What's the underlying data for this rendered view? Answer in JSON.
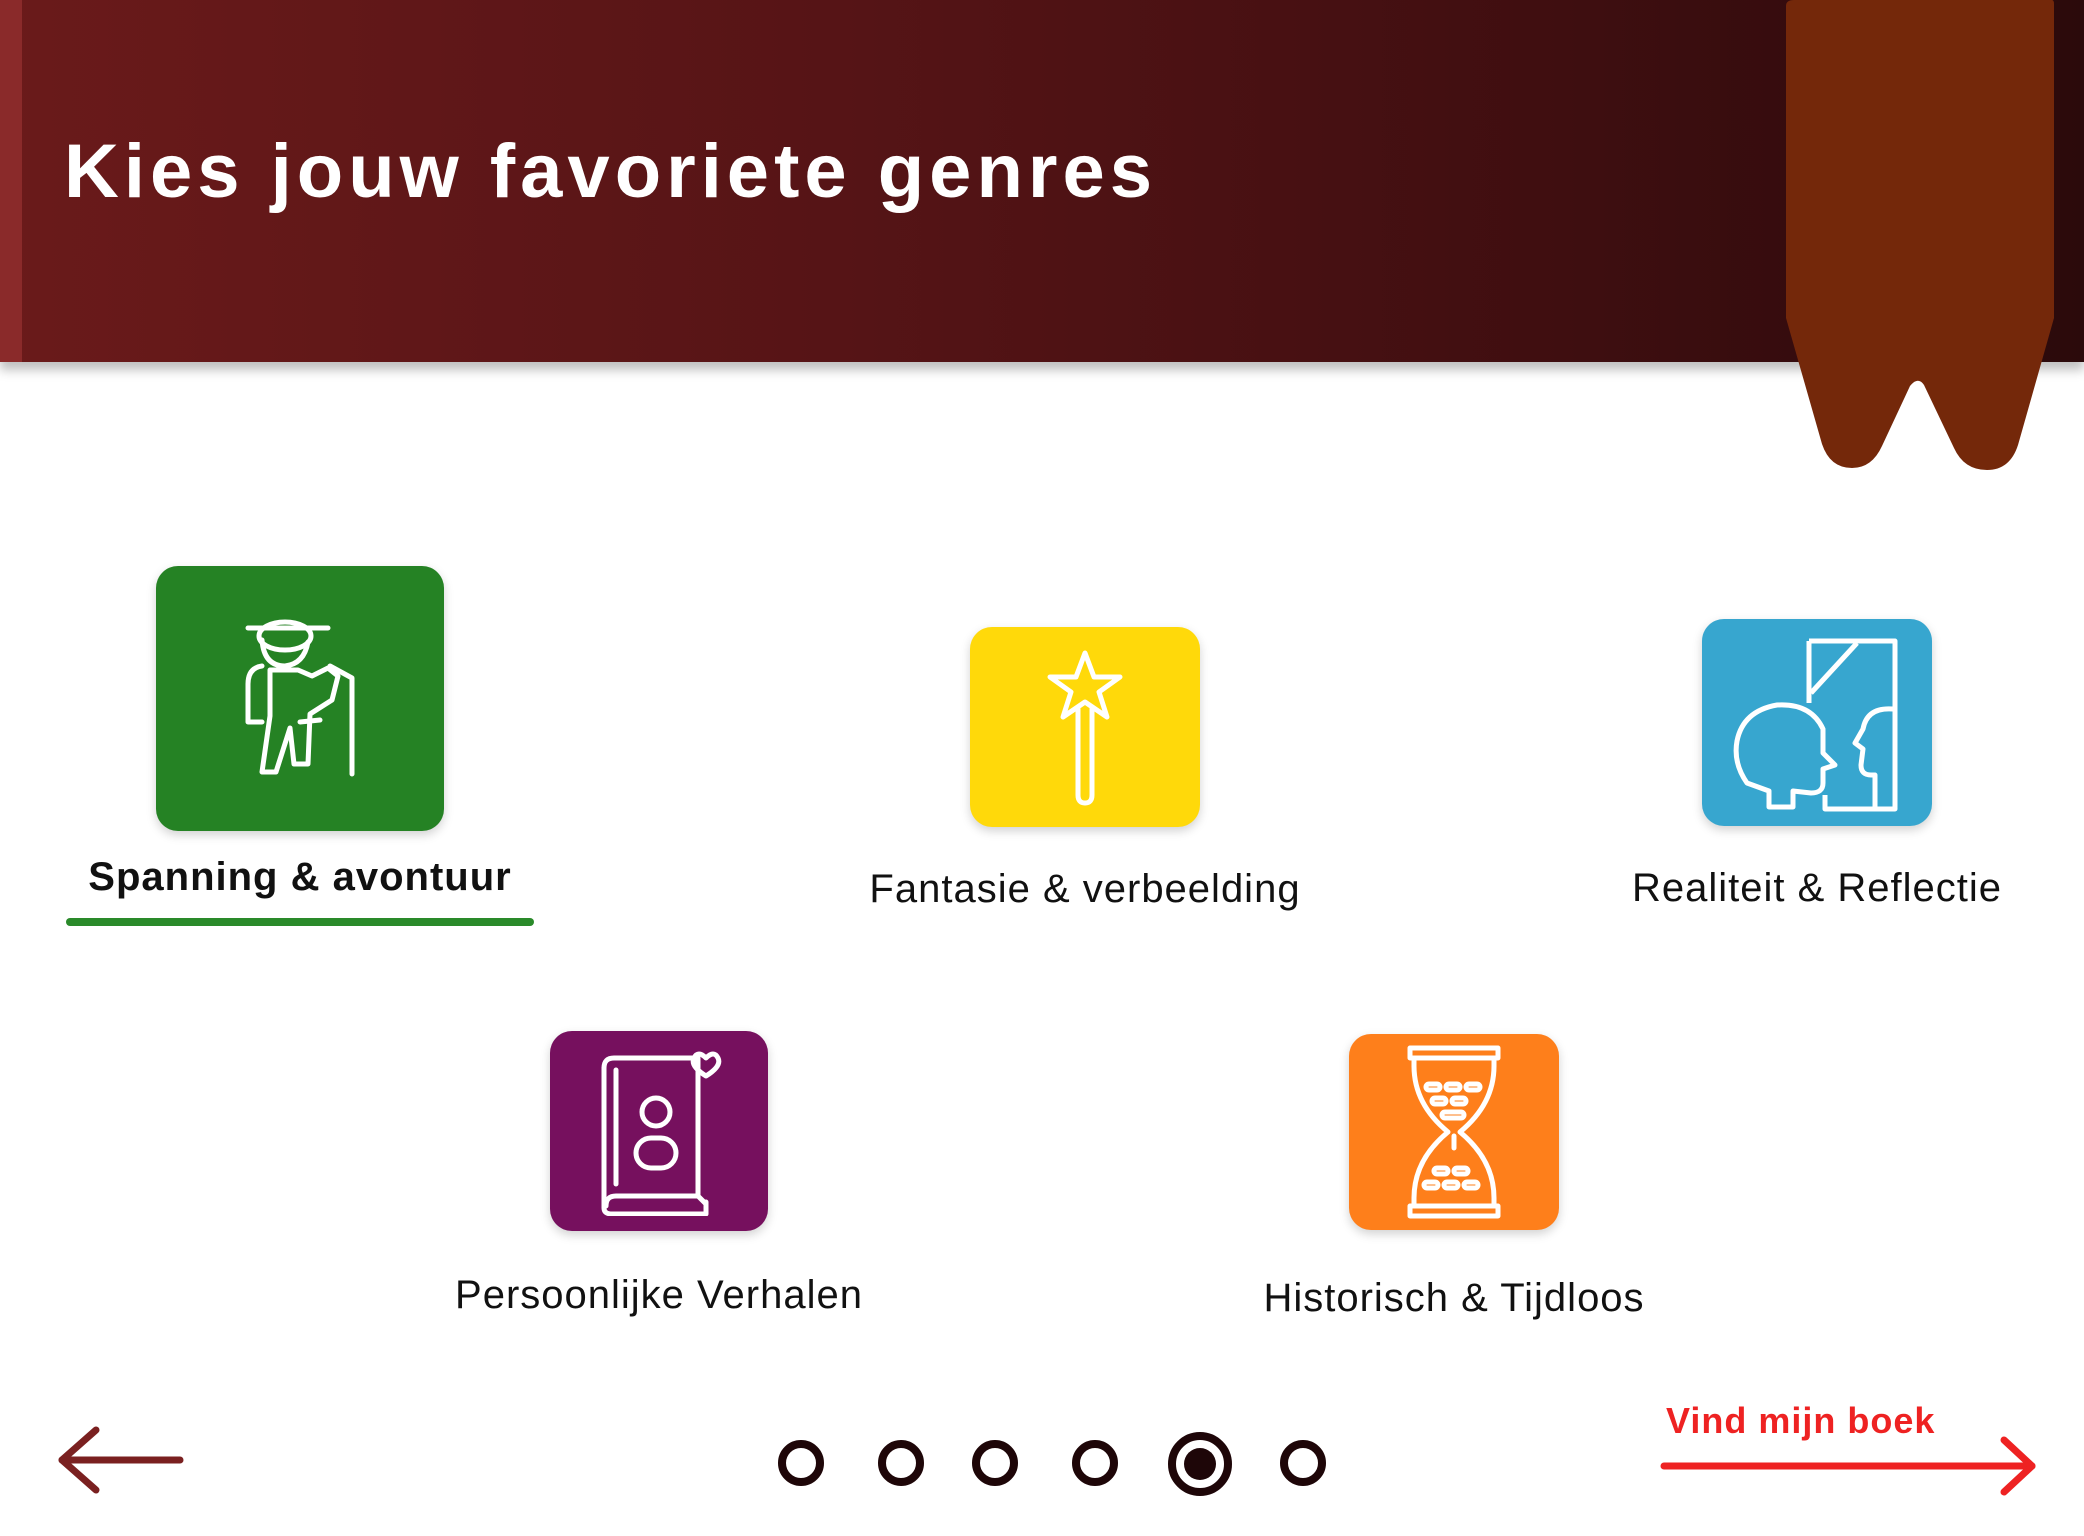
{
  "header": {
    "title": "Kies jouw favoriete genres"
  },
  "genres": [
    {
      "label": "Spanning & avontuur",
      "color": "#258224",
      "icon": "hiker-icon",
      "selected": true
    },
    {
      "label": "Fantasie & verbeelding",
      "color": "#ffd90a",
      "icon": "magic-wand-icon",
      "selected": false
    },
    {
      "label": "Realiteit & Reflectie",
      "color": "#37a6cf",
      "icon": "mirror-reflection-icon",
      "selected": false
    },
    {
      "label": "Persoonlijke Verhalen",
      "color": "#76105e",
      "icon": "biography-book-icon",
      "selected": false
    },
    {
      "label": "Historisch & Tijdloos",
      "color": "#fe7f1b",
      "icon": "hourglass-icon",
      "selected": false
    }
  ],
  "pagination": {
    "total_steps": 6,
    "current_step": 5
  },
  "navigation": {
    "back_icon": "arrow-left-icon",
    "next_label": "Vind mijn boek",
    "next_icon": "arrow-right-icon"
  },
  "colors": {
    "header": "#561416",
    "bookmark": "#74280a",
    "next_link": "#ee2222",
    "back_arrow": "#7a2020",
    "selected_underline": "#2a8a2a",
    "dot": "#1e0608"
  }
}
